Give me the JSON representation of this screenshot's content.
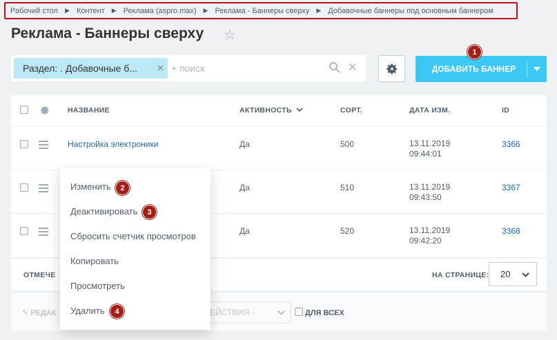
{
  "breadcrumb": [
    "Рабочий стол",
    "Контент",
    "Реклама (aspro.max)",
    "Реклама - Баннеры сверху",
    "Добавочные баннеры под основным баннером"
  ],
  "title": "Реклама - Баннеры сверху",
  "filter": {
    "tag": "Раздел: . Добавочные б...",
    "placeholder": "+ поиск"
  },
  "add_button": {
    "label": "ДОБАВИТЬ БАННЕР"
  },
  "badges": [
    "1",
    "2",
    "3",
    "4"
  ],
  "grid": {
    "columns": {
      "name": "НАЗВАНИЕ",
      "active": "АКТИВНОСТЬ",
      "sort": "СОРТ.",
      "date": "ДАТА ИЗМ.",
      "id": "ID"
    },
    "rows": [
      {
        "name": "Настройка электроники",
        "active": "Да",
        "sort": "500",
        "date": "13.11.2019",
        "time": "09:44:01",
        "id": "3366"
      },
      {
        "name": "",
        "active": "Да",
        "sort": "510",
        "date": "13.11.2019",
        "time": "09:43:50",
        "id": "3367"
      },
      {
        "name": "",
        "active": "Да",
        "sort": "520",
        "date": "13.11.2019",
        "time": "09:42:20",
        "id": "3368"
      }
    ],
    "footer": {
      "selected": "ОТМЕЧЕ",
      "per_page_label": "НА СТРАНИЦЕ:",
      "per_page_value": "20"
    }
  },
  "toolbar": {
    "edit": "РЕДАК",
    "actions": "ЕЙСТВИЯ -",
    "for_all": "ДЛЯ ВСЕХ"
  },
  "context_menu": [
    "Изменить",
    "Деактивировать",
    "Сбросить счетчик просмотров",
    "Копировать",
    "Просмотреть",
    "Удалить"
  ],
  "colors": {
    "accent": "#3bc8f5",
    "badge": "#a51d17",
    "link": "#2067b0",
    "highlight": "#b5121b"
  }
}
